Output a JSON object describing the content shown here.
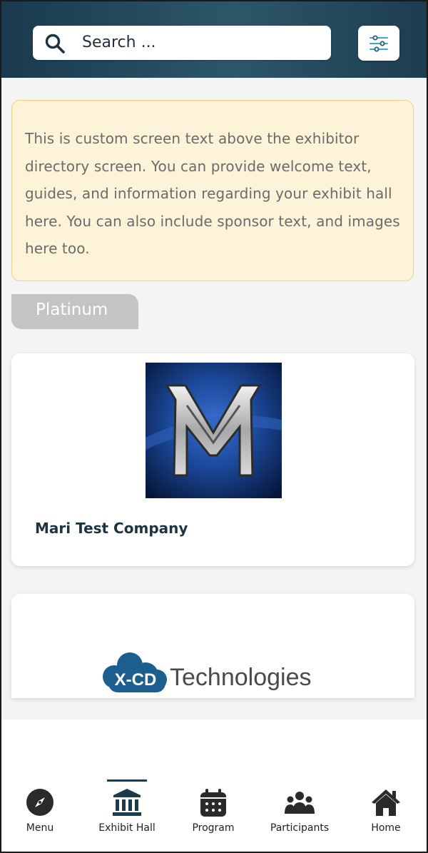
{
  "search": {
    "placeholder": "Search ..."
  },
  "filter": {
    "icon": "sliders-icon"
  },
  "info_box": {
    "text": "This is custom screen text above the exhibitor directory screen. You can provide welcome text, guides, and information regarding your exhibit hall here. You can also include sponsor text, and images here too.",
    "bg_color": "#fdf3d8",
    "border_color": "#f1cf88"
  },
  "tier": {
    "label": "Platinum"
  },
  "exhibitors": [
    {
      "name": "Mari Test Company",
      "logo": "m-logo"
    },
    {
      "name": "",
      "logo": "xcd-technologies-logo",
      "logo_text_badge": "X-CD",
      "logo_text_word": "Technologies"
    }
  ],
  "tabbar": {
    "active": "Exhibit Hall",
    "items": [
      {
        "label": "Menu",
        "icon": "compass-icon"
      },
      {
        "label": "Exhibit Hall",
        "icon": "building-icon"
      },
      {
        "label": "Program",
        "icon": "calendar-icon"
      },
      {
        "label": "Participants",
        "icon": "people-icon"
      },
      {
        "label": "Home",
        "icon": "home-icon"
      }
    ]
  },
  "colors": {
    "header": "#234858",
    "accent": "#1e3a4b",
    "tier_badge": "#c4c4c4"
  }
}
